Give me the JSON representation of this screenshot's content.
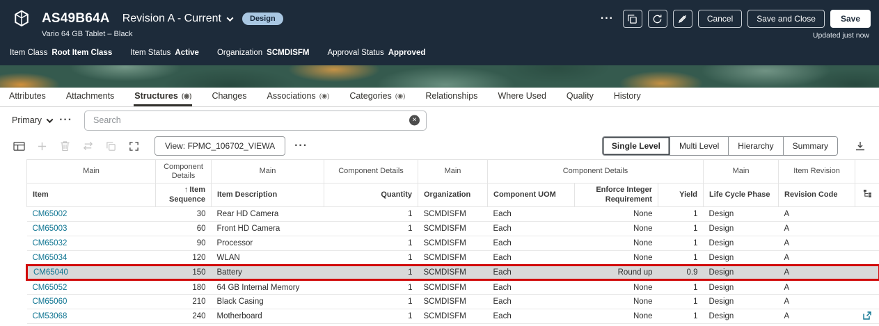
{
  "header": {
    "title": "AS49B64A",
    "revision": "Revision A - Current",
    "badge": "Design",
    "subtitle": "Vario 64 GB Tablet – Black",
    "updated": "Updated just now",
    "buttons": {
      "cancel": "Cancel",
      "save_and_close": "Save and Close",
      "save": "Save"
    },
    "info": [
      {
        "label": "Item Class",
        "value": "Root Item Class"
      },
      {
        "label": "Item Status",
        "value": "Active"
      },
      {
        "label": "Organization",
        "value": "SCMDISFM"
      },
      {
        "label": "Approval Status",
        "value": "Approved"
      }
    ]
  },
  "tabs": [
    {
      "label": "Attributes"
    },
    {
      "label": "Attachments"
    },
    {
      "label": "Structures",
      "marker": true,
      "active": true
    },
    {
      "label": "Changes"
    },
    {
      "label": "Associations",
      "marker": true
    },
    {
      "label": "Categories",
      "marker": true
    },
    {
      "label": "Relationships"
    },
    {
      "label": "Where Used"
    },
    {
      "label": "Quality"
    },
    {
      "label": "History"
    }
  ],
  "filter": {
    "primary_label": "Primary",
    "search_placeholder": "Search"
  },
  "toolbar": {
    "view_button": "View: FPMC_106702_VIEWA",
    "levels": [
      "Single Level",
      "Multi Level",
      "Hierarchy",
      "Summary"
    ],
    "active_level": "Single Level"
  },
  "table": {
    "groups": [
      {
        "label": "Main",
        "span": 1
      },
      {
        "label": "Component Details",
        "span": 1
      },
      {
        "label": "Main",
        "span": 1
      },
      {
        "label": "Component Details",
        "span": 1
      },
      {
        "label": "Main",
        "span": 1
      },
      {
        "label": "Component Details",
        "span": 3
      },
      {
        "label": "Main",
        "span": 1
      },
      {
        "label": "Item Revision",
        "span": 1
      }
    ],
    "columns": [
      {
        "key": "item",
        "label": "Item",
        "align": "left"
      },
      {
        "key": "seq",
        "label": "Item Sequence",
        "align": "right",
        "sorted": "ascending"
      },
      {
        "key": "desc",
        "label": "Item Description",
        "align": "left"
      },
      {
        "key": "qty",
        "label": "Quantity",
        "align": "right"
      },
      {
        "key": "org",
        "label": "Organization",
        "align": "left"
      },
      {
        "key": "uom",
        "label": "Component UOM",
        "align": "left"
      },
      {
        "key": "enforce",
        "label": "Enforce Integer Requirement",
        "align": "right"
      },
      {
        "key": "yield",
        "label": "Yield",
        "align": "right"
      },
      {
        "key": "phase",
        "label": "Life Cycle Phase",
        "align": "left"
      },
      {
        "key": "rev",
        "label": "Revision Code",
        "align": "left"
      }
    ],
    "rows": [
      {
        "item": "CM65002",
        "seq": "30",
        "desc": "Rear HD Camera",
        "qty": "1",
        "org": "SCMDISFM",
        "uom": "Each",
        "enforce": "None",
        "yield": "1",
        "phase": "Design",
        "rev": "A"
      },
      {
        "item": "CM65003",
        "seq": "60",
        "desc": "Front HD Camera",
        "qty": "1",
        "org": "SCMDISFM",
        "uom": "Each",
        "enforce": "None",
        "yield": "1",
        "phase": "Design",
        "rev": "A"
      },
      {
        "item": "CM65032",
        "seq": "90",
        "desc": "Processor",
        "qty": "1",
        "org": "SCMDISFM",
        "uom": "Each",
        "enforce": "None",
        "yield": "1",
        "phase": "Design",
        "rev": "A"
      },
      {
        "item": "CM65034",
        "seq": "120",
        "desc": "WLAN",
        "qty": "1",
        "org": "SCMDISFM",
        "uom": "Each",
        "enforce": "None",
        "yield": "1",
        "phase": "Design",
        "rev": "A"
      },
      {
        "item": "CM65040",
        "seq": "150",
        "desc": "Battery",
        "qty": "1",
        "org": "SCMDISFM",
        "uom": "Each",
        "enforce": "Round up",
        "yield": "0.9",
        "phase": "Design",
        "rev": "A",
        "selected": true,
        "annotated": true
      },
      {
        "item": "CM65052",
        "seq": "180",
        "desc": "64 GB Internal Memory",
        "qty": "1",
        "org": "SCMDISFM",
        "uom": "Each",
        "enforce": "None",
        "yield": "1",
        "phase": "Design",
        "rev": "A"
      },
      {
        "item": "CM65060",
        "seq": "210",
        "desc": "Black Casing",
        "qty": "1",
        "org": "SCMDISFM",
        "uom": "Each",
        "enforce": "None",
        "yield": "1",
        "phase": "Design",
        "rev": "A"
      },
      {
        "item": "CM53068",
        "seq": "240",
        "desc": "Motherboard",
        "qty": "1",
        "org": "SCMDISFM",
        "uom": "Each",
        "enforce": "None",
        "yield": "1",
        "phase": "Design",
        "rev": "A",
        "open_icon": true
      }
    ]
  },
  "annotation": {
    "type": "red-rectangle",
    "target_row_item": "CM65040"
  },
  "colors": {
    "header_background": "#1d2b3a",
    "banner_background": "#355a4e",
    "banner_accent": "#d9933b",
    "link": "#0f7592",
    "badge_background": "#a9c7e2",
    "selected_row_background": "#d9d9d9",
    "annotation_red": "#d10b0b",
    "active_tab_underline": "#35332f"
  }
}
